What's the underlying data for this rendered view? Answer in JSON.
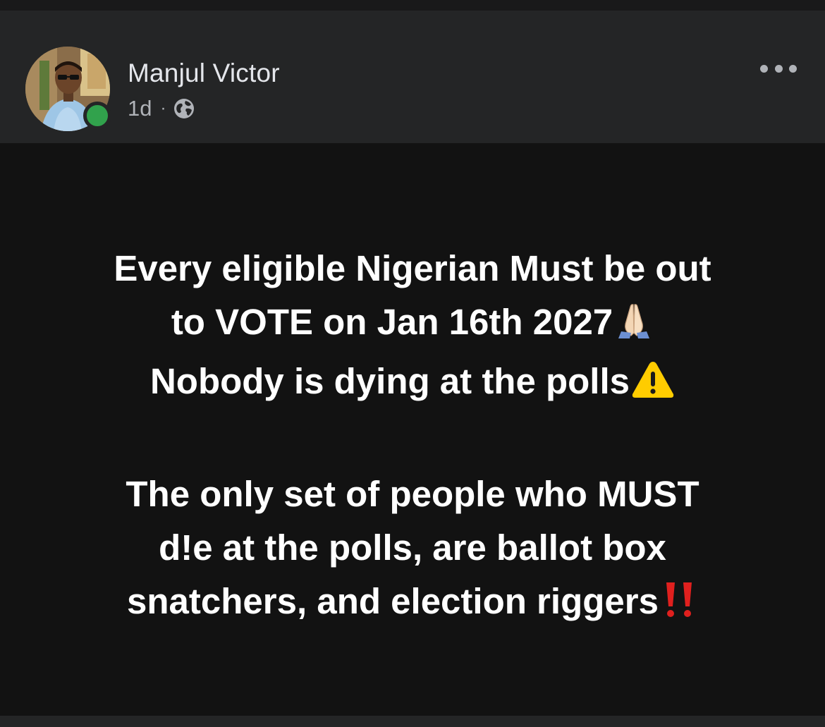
{
  "post": {
    "author": {
      "name": "Manjul Victor",
      "online": true
    },
    "meta": {
      "time": "1d",
      "separator": "·",
      "privacy_icon": "globe-icon"
    },
    "menu_icon": "more-horizontal-icon",
    "text_lines": [
      "Every eligible Nigerian Must be out",
      "to VOTE on Jan 16th 2027",
      "Nobody is dying at the polls",
      "The only set of people who MUST",
      "d!e at the polls, are ballot box",
      "snatchers, and election riggers"
    ],
    "emojis": {
      "line2": "folded-hands-emoji",
      "line3": "warning-emoji",
      "line6": "double-exclamation-emoji"
    }
  },
  "colors": {
    "header_bg": "#242526",
    "body_bg": "#121212",
    "name_text": "#e4e6eb",
    "meta_text": "#b0b3b8",
    "online_green": "#31a24c",
    "post_text": "#ffffff",
    "warning_yellow": "#ffcc00",
    "exclamation_red": "#e0201e"
  }
}
